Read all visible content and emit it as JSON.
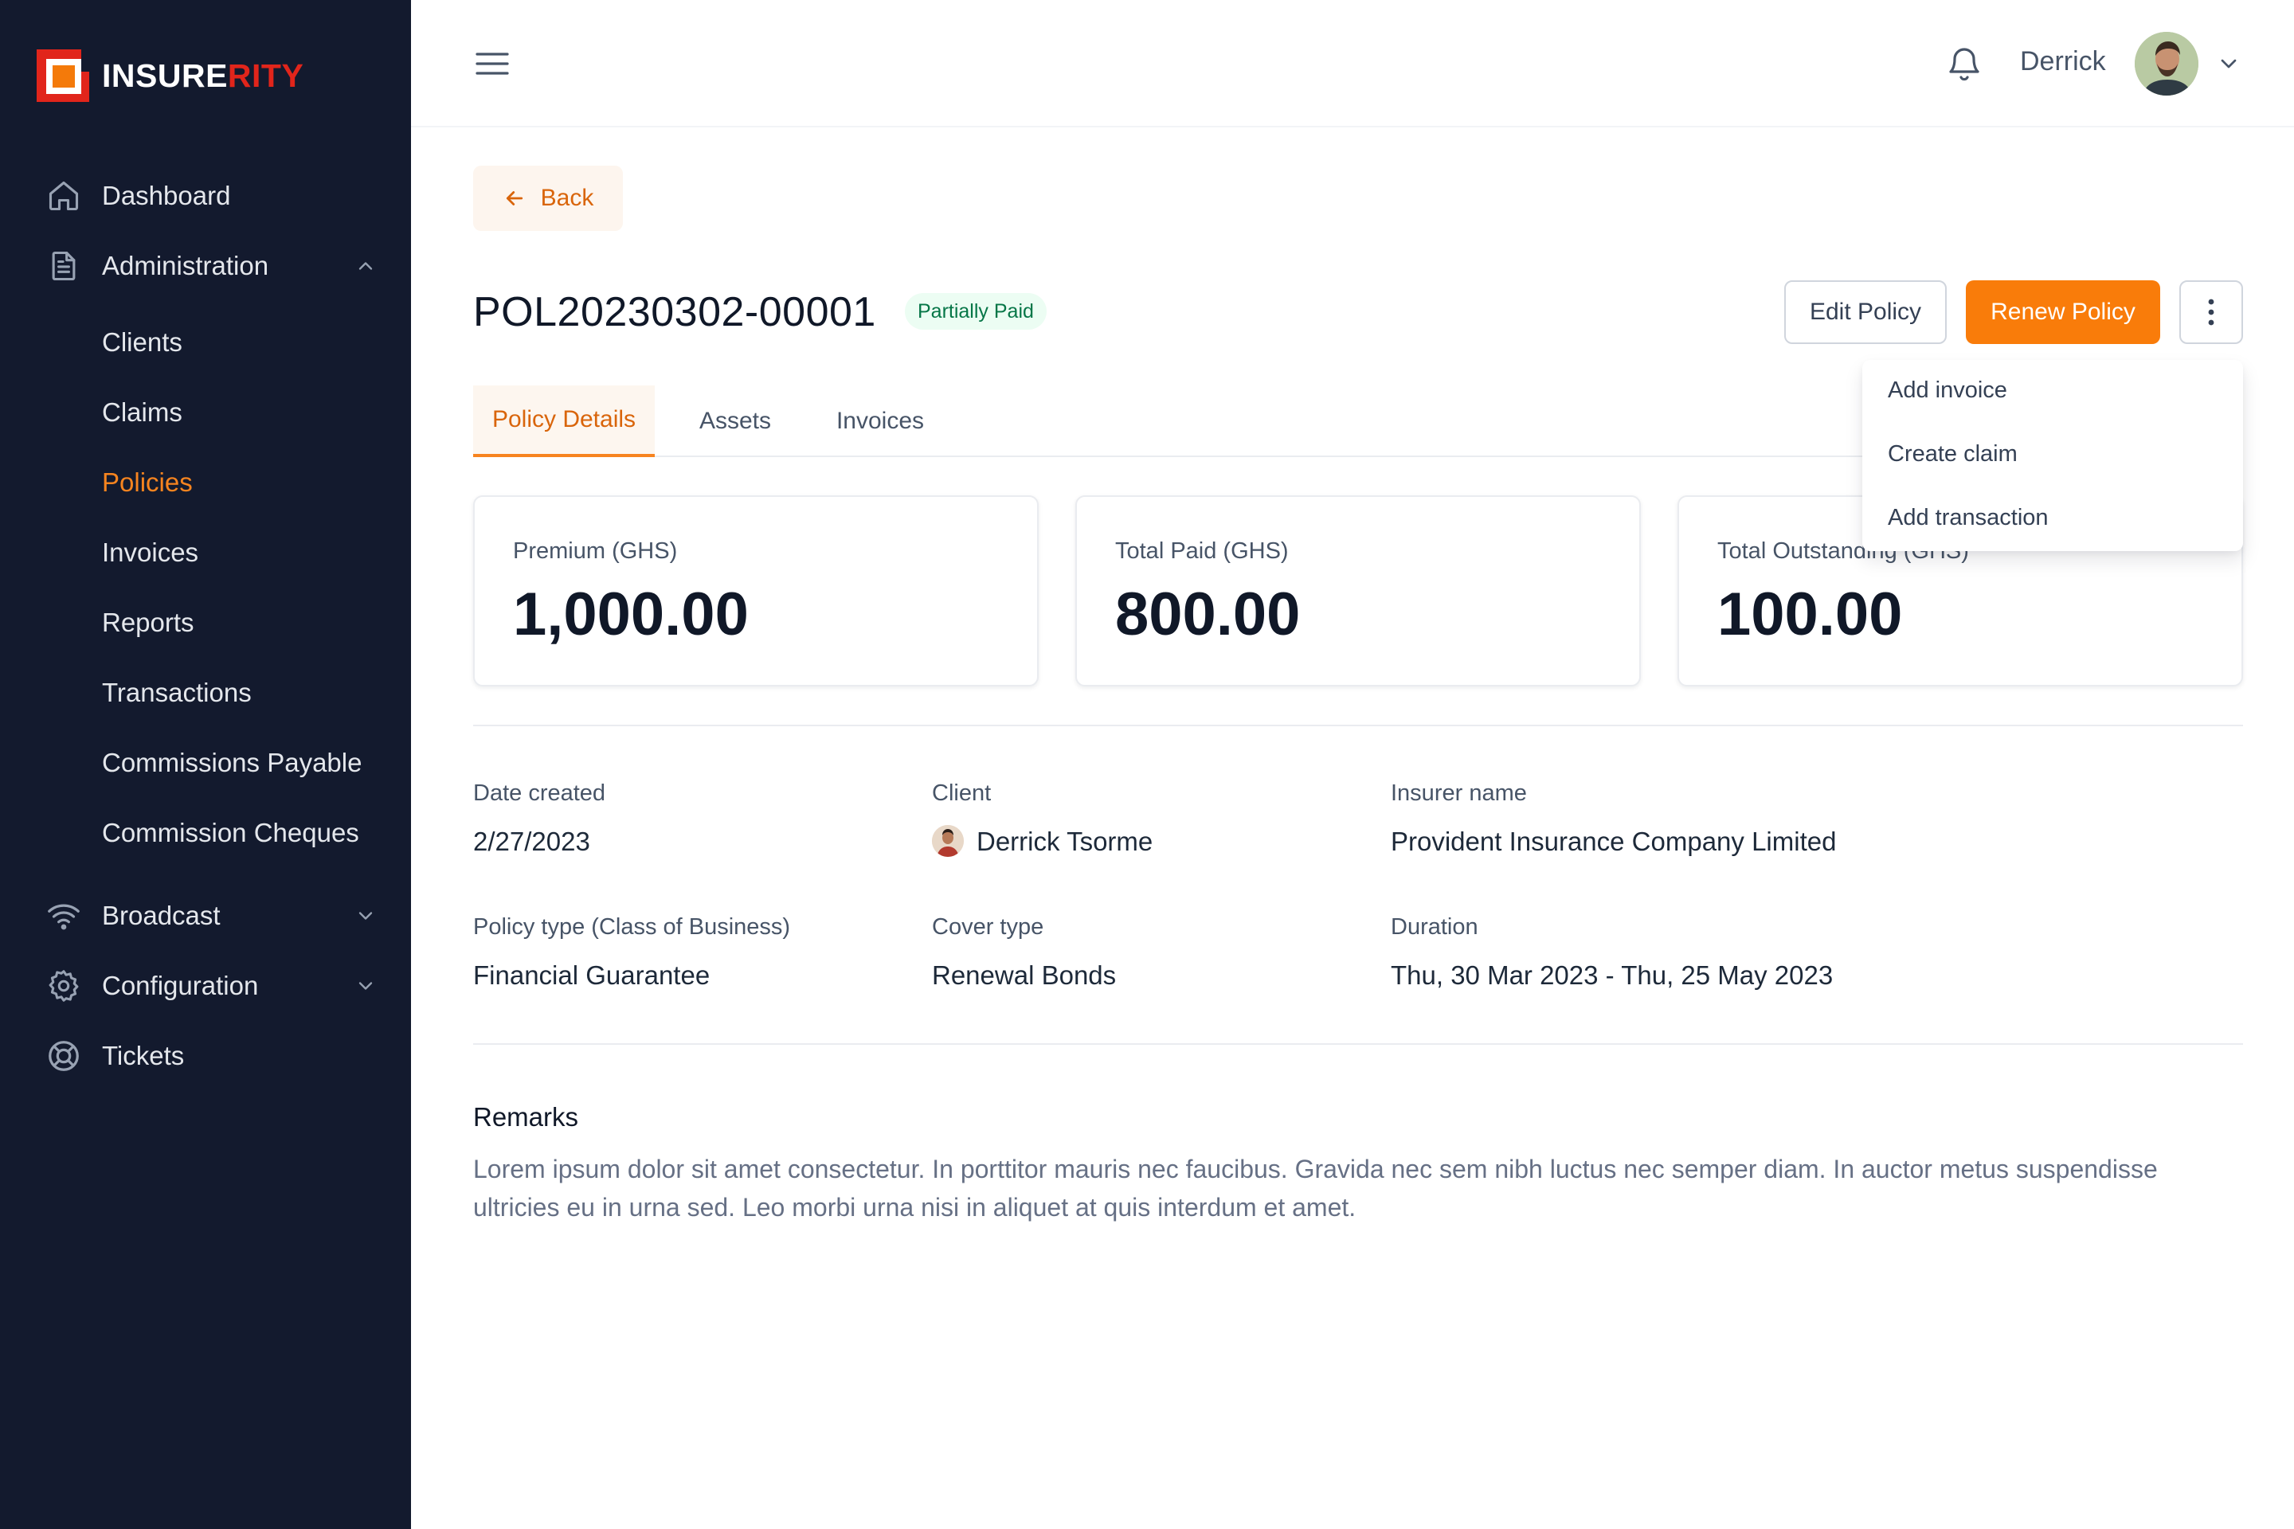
{
  "brand": {
    "name_part1": "INSURE",
    "name_part2": "RITY"
  },
  "sidebar": {
    "items": [
      {
        "label": "Dashboard",
        "icon": "home-icon"
      },
      {
        "label": "Administration",
        "icon": "document-icon",
        "expanded": true
      },
      {
        "label": "Broadcast",
        "icon": "wifi-icon"
      },
      {
        "label": "Configuration",
        "icon": "gear-icon"
      },
      {
        "label": "Tickets",
        "icon": "lifebuoy-icon"
      }
    ],
    "sub_items": [
      {
        "label": "Clients"
      },
      {
        "label": "Claims"
      },
      {
        "label": "Policies",
        "active": true
      },
      {
        "label": "Invoices"
      },
      {
        "label": "Reports"
      },
      {
        "label": "Transactions"
      },
      {
        "label": "Commissions Payable"
      },
      {
        "label": "Commission Cheques"
      }
    ]
  },
  "header": {
    "user_name": "Derrick"
  },
  "page": {
    "back_label": "Back",
    "policy_number": "POL20230302-00001",
    "status": "Partially Paid",
    "edit_label": "Edit Policy",
    "renew_label": "Renew Policy"
  },
  "tabs": [
    {
      "label": "Policy Details",
      "active": true
    },
    {
      "label": "Assets"
    },
    {
      "label": "Invoices"
    }
  ],
  "dropdown": {
    "items": [
      "Add invoice",
      "Create claim",
      "Add transaction"
    ]
  },
  "cards": [
    {
      "label": "Premium (GHS)",
      "value": "1,000.00"
    },
    {
      "label": "Total Paid (GHS)",
      "value": "800.00"
    },
    {
      "label": "Total Outstanding (GHS)",
      "value": "100.00"
    }
  ],
  "details": {
    "date_created": {
      "label": "Date created",
      "value": "2/27/2023"
    },
    "client": {
      "label": "Client",
      "value": "Derrick Tsorme"
    },
    "insurer": {
      "label": "Insurer name",
      "value": "Provident Insurance Company Limited"
    },
    "policy_type": {
      "label": "Policy type (Class of Business)",
      "value": "Financial Guarantee"
    },
    "cover_type": {
      "label": "Cover type",
      "value": "Renewal Bonds"
    },
    "duration": {
      "label": "Duration",
      "value": "Thu, 30 Mar 2023 - Thu, 25 May 2023"
    }
  },
  "remarks": {
    "title": "Remarks",
    "text": "Lorem ipsum dolor sit amet consectetur. In porttitor mauris nec faucibus. Gravida nec sem nibh luctus nec semper diam. In auctor metus suspendisse ultricies eu in urna sed. Leo morbi urna nisi in aliquet at quis interdum et amet."
  },
  "colors": {
    "sidebar_bg": "#131a2e",
    "accent": "#f97c0a",
    "brand_red": "#e1251b",
    "status_bg": "#ecfdf3",
    "status_text": "#067647"
  }
}
